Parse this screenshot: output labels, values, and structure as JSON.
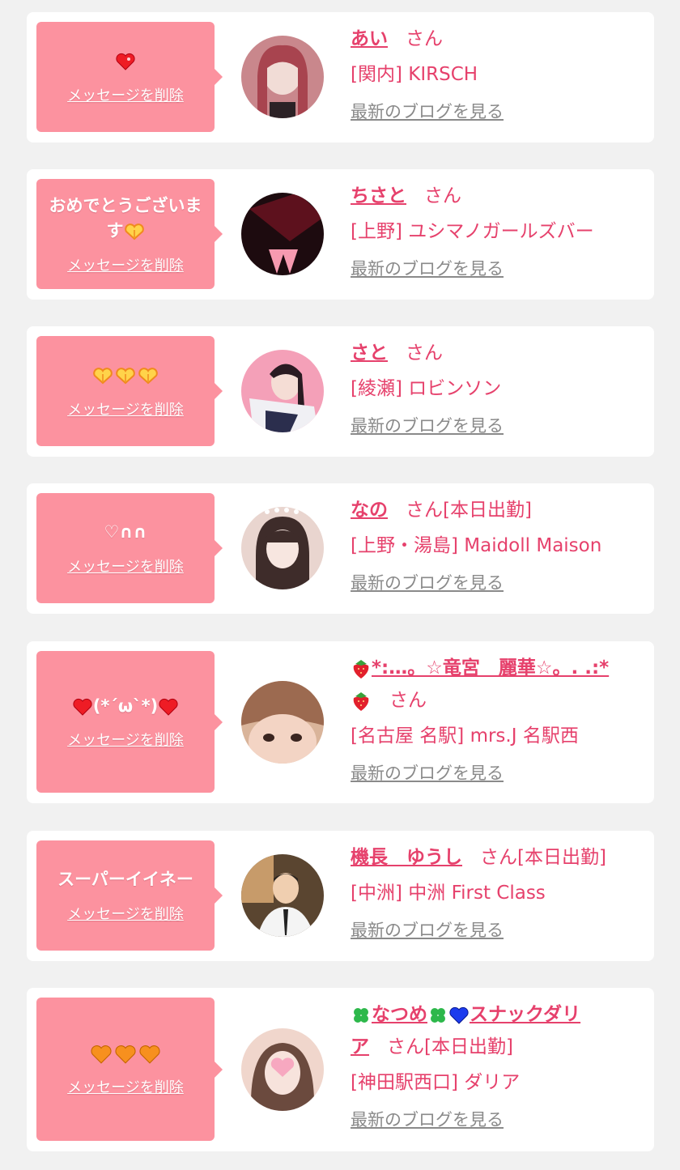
{
  "common": {
    "delete_label": "メッセージを削除",
    "san_suffix": "さん",
    "blog_label": "最新のブログを見る"
  },
  "cards": [
    {
      "message": "",
      "message_icons": [
        "heart-red-icon"
      ],
      "name": "あい",
      "san": "さん",
      "shop": "[関内] KIRSCH",
      "avatar_colors": [
        "#c9878c",
        "#6e3540"
      ]
    },
    {
      "message": "おめでとうございます",
      "message_icons": [
        "heart-hands-icon"
      ],
      "name": "ちさと",
      "san": "さん",
      "shop": "[上野] ユシマノガールズバー",
      "avatar_colors": [
        "#2a1015",
        "#8a1a2a"
      ]
    },
    {
      "message": "",
      "message_icons": [
        "heart-hands-icon",
        "heart-hands-icon",
        "heart-hands-icon"
      ],
      "name": "さと",
      "san": "さん",
      "shop": "[綾瀬] ロビンソン",
      "avatar_colors": [
        "#f4a0b8",
        "#2b2e4d"
      ]
    },
    {
      "message": "♡∩∩",
      "message_icons": [],
      "name": "なの",
      "san": "さん[本日出勤]",
      "shop": "[上野・湯島] Maidoll Maison",
      "avatar_colors": [
        "#e9d5cf",
        "#5a4541"
      ]
    },
    {
      "message": "(*´ω`*)",
      "message_icons": [
        "heart-red-icon"
      ],
      "name_line1": "*:…。☆竜宮　麗華☆。. .:*",
      "name_line2": "",
      "name_icons": [
        "strawberry-icon"
      ],
      "san": "さん",
      "shop": "[名古屋 名駅] mrs.J 名駅西",
      "avatar_colors": [
        "#d9b49a",
        "#7a5040"
      ]
    },
    {
      "message": "スーパーイイネー",
      "message_icons": [],
      "name": "機長　ゆうし",
      "san": "さん[本日出勤]",
      "shop": "[中洲] 中洲 First Class",
      "avatar_colors": [
        "#c79b6a",
        "#2c2520"
      ]
    },
    {
      "message": "",
      "message_icons": [
        "heart-orange-icon",
        "heart-orange-icon",
        "heart-orange-icon"
      ],
      "name_part1": "なつめ",
      "name_part2": "スナックダリ",
      "name_part3": "ア",
      "name_icons": [
        "clover-icon",
        "heart-blue-icon"
      ],
      "san": "さん[本日出勤]",
      "shop": "[神田駅西口] ダリア",
      "avatar_colors": [
        "#f0d6cc",
        "#6b4a3e"
      ]
    }
  ],
  "colors": {
    "background": "#f1f1f1",
    "bubble": "#fc929f",
    "accent": "#e6416c",
    "blog_link": "#8a8a8a"
  }
}
